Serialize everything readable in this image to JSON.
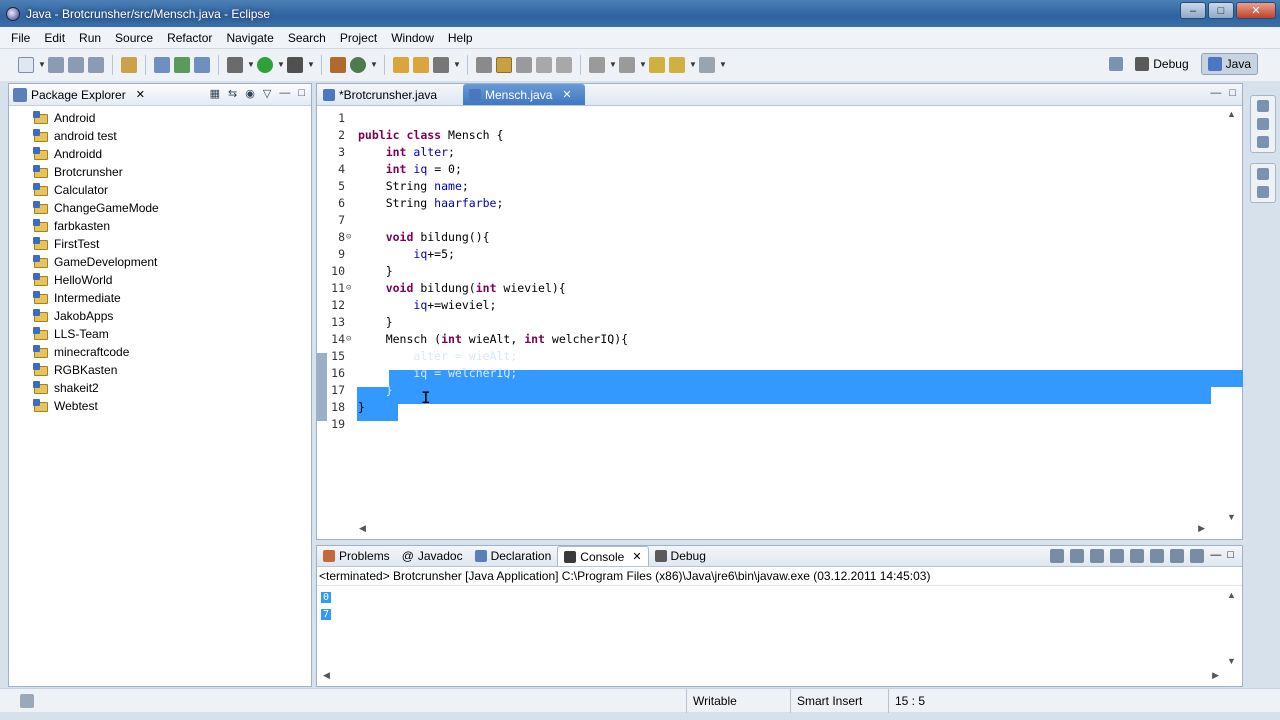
{
  "window": {
    "title": "Java - Brotcrunsher/src/Mensch.java - Eclipse"
  },
  "menu": [
    "File",
    "Edit",
    "Run",
    "Source",
    "Refactor",
    "Navigate",
    "Search",
    "Project",
    "Window",
    "Help"
  ],
  "perspectives": {
    "debug": "Debug",
    "java": "Java"
  },
  "package_explorer": {
    "title": "Package Explorer",
    "projects": [
      "Android",
      "android test",
      "Androidd",
      "Brotcrunsher",
      "Calculator",
      "ChangeGameMode",
      "farbkasten",
      "FirstTest",
      "GameDevelopment",
      "HelloWorld",
      "Intermediate",
      "JakobApps",
      "LLS-Team",
      "minecraftcode",
      "RGBKasten",
      "shakeit2",
      "Webtest"
    ]
  },
  "editor": {
    "tabs": [
      {
        "label": "*Brotcrunsher.java",
        "active": false
      },
      {
        "label": "Mensch.java",
        "active": true
      }
    ],
    "lines": [
      {
        "n": "1",
        "code": ""
      },
      {
        "n": "2",
        "code": "public class Mensch {"
      },
      {
        "n": "3",
        "code": "    int alter;"
      },
      {
        "n": "4",
        "code": "    int iq = 0;"
      },
      {
        "n": "5",
        "code": "    String name;"
      },
      {
        "n": "6",
        "code": "    String haarfarbe;"
      },
      {
        "n": "7",
        "code": ""
      },
      {
        "n": "8",
        "code": "    void bildung(){"
      },
      {
        "n": "9",
        "code": "        iq+=5;"
      },
      {
        "n": "10",
        "code": "    }"
      },
      {
        "n": "11",
        "code": "    void bildung(int wieviel){"
      },
      {
        "n": "12",
        "code": "        iq+=wieviel;"
      },
      {
        "n": "13",
        "code": "    }"
      },
      {
        "n": "14",
        "code": "    Mensch (int wieAlt, int welcherIQ){"
      },
      {
        "n": "15",
        "code": "        alter = wieAlt;"
      },
      {
        "n": "16",
        "code": "        iq = welcherIQ;"
      },
      {
        "n": "17",
        "code": "    }"
      },
      {
        "n": "18",
        "code": "}"
      },
      {
        "n": "19",
        "code": ""
      }
    ]
  },
  "console": {
    "tabs": [
      "Problems",
      "Javadoc",
      "Declaration",
      "Console",
      "Debug"
    ],
    "active_tab": "Console",
    "status": "<terminated> Brotcrunsher [Java Application] C:\\Program Files (x86)\\Java\\jre6\\bin\\javaw.exe (03.12.2011 14:45:03)",
    "output": [
      "0",
      "7"
    ]
  },
  "statusbar": {
    "writable": "Writable",
    "insert_mode": "Smart Insert",
    "position": "15 : 5"
  }
}
